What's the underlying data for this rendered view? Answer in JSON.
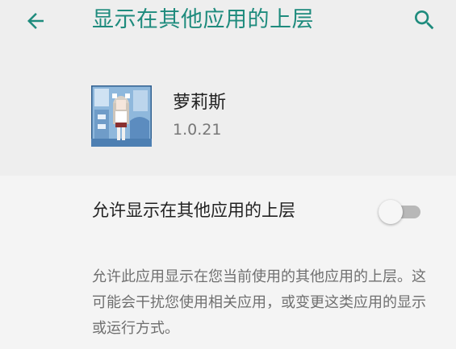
{
  "toolbar": {
    "title": "显示在其他应用的上层",
    "back_icon": "arrow-back-icon",
    "search_icon": "search-icon",
    "accent_color": "#1e8b7d"
  },
  "app": {
    "name": "萝莉斯",
    "version": "1.0.21"
  },
  "permission": {
    "label": "允许显示在其他应用的上层",
    "enabled": false,
    "description": "允许此应用显示在您当前使用的其他应用的上层。这可能会干扰您使用相关应用，或变更这类应用的显示或运行方式。"
  }
}
